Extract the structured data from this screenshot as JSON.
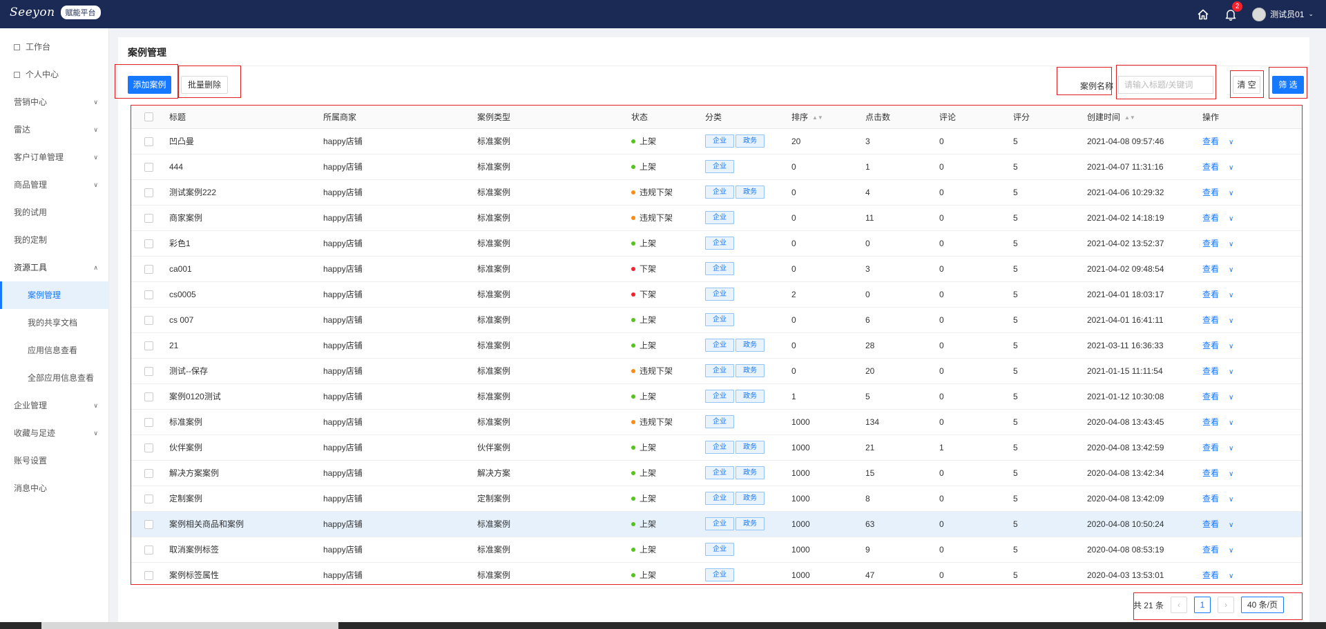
{
  "header": {
    "logo_text": "Seeyon",
    "platform_badge": "赋能平台",
    "notification_count": "2",
    "user_name": "测试员01"
  },
  "sidebar": {
    "items": [
      {
        "label": "工作台",
        "type": "page"
      },
      {
        "label": "个人中心",
        "type": "page"
      },
      {
        "label": "营销中心",
        "type": "group"
      },
      {
        "label": "雷达",
        "type": "group"
      },
      {
        "label": "客户订单管理",
        "type": "group"
      },
      {
        "label": "商品管理",
        "type": "group"
      },
      {
        "label": "我的试用",
        "type": "link"
      },
      {
        "label": "我的定制",
        "type": "link"
      },
      {
        "label": "资源工具",
        "type": "group-open"
      },
      {
        "label": "案例管理",
        "type": "sub-active"
      },
      {
        "label": "我的共享文档",
        "type": "sub"
      },
      {
        "label": "应用信息查看",
        "type": "sub"
      },
      {
        "label": "全部应用信息查看",
        "type": "sub"
      },
      {
        "label": "企业管理",
        "type": "group"
      },
      {
        "label": "收藏与足迹",
        "type": "group"
      },
      {
        "label": "账号设置",
        "type": "link"
      },
      {
        "label": "消息中心",
        "type": "link"
      }
    ]
  },
  "main": {
    "title": "案例管理",
    "add_button": "添加案例",
    "batch_delete_button": "批量删除",
    "filter_label": "案例名称",
    "filter_placeholder": "请输入标题/关键词",
    "clear_button": "清 空",
    "filter_button": "筛 选"
  },
  "table": {
    "columns": [
      "标题",
      "所属商家",
      "案例类型",
      "状态",
      "分类",
      "排序",
      "点击数",
      "评论",
      "评分",
      "创建时间",
      "操作"
    ],
    "view_label": "查看",
    "rows": [
      {
        "title": "凹凸曼",
        "merchant": "happy店铺",
        "type": "标准案例",
        "status": "上架",
        "status_color": "#52c41a",
        "tags": [
          "企业",
          "政务"
        ],
        "order": "20",
        "clicks": "3",
        "comments": "0",
        "rating": "5",
        "created": "2021-04-08 09:57:46"
      },
      {
        "title": "444",
        "merchant": "happy店铺",
        "type": "标准案例",
        "status": "上架",
        "status_color": "#52c41a",
        "tags": [
          "企业"
        ],
        "order": "0",
        "clicks": "1",
        "comments": "0",
        "rating": "5",
        "created": "2021-04-07 11:31:16"
      },
      {
        "title": "测试案例222",
        "merchant": "happy店铺",
        "type": "标准案例",
        "status": "违规下架",
        "status_color": "#fa8c16",
        "tags": [
          "企业",
          "政务"
        ],
        "order": "0",
        "clicks": "4",
        "comments": "0",
        "rating": "5",
        "created": "2021-04-06 10:29:32"
      },
      {
        "title": "商家案例",
        "merchant": "happy店铺",
        "type": "标准案例",
        "status": "违规下架",
        "status_color": "#fa8c16",
        "tags": [
          "企业"
        ],
        "order": "0",
        "clicks": "11",
        "comments": "0",
        "rating": "5",
        "created": "2021-04-02 14:18:19"
      },
      {
        "title": "彩色1",
        "merchant": "happy店铺",
        "type": "标准案例",
        "status": "上架",
        "status_color": "#52c41a",
        "tags": [
          "企业"
        ],
        "order": "0",
        "clicks": "0",
        "comments": "0",
        "rating": "5",
        "created": "2021-04-02 13:52:37"
      },
      {
        "title": "ca001",
        "merchant": "happy店铺",
        "type": "标准案例",
        "status": "下架",
        "status_color": "#f5222d",
        "tags": [
          "企业"
        ],
        "order": "0",
        "clicks": "3",
        "comments": "0",
        "rating": "5",
        "created": "2021-04-02 09:48:54"
      },
      {
        "title": "cs0005",
        "merchant": "happy店铺",
        "type": "标准案例",
        "status": "下架",
        "status_color": "#f5222d",
        "tags": [
          "企业"
        ],
        "order": "2",
        "clicks": "0",
        "comments": "0",
        "rating": "5",
        "created": "2021-04-01 18:03:17"
      },
      {
        "title": "cs 007",
        "merchant": "happy店铺",
        "type": "标准案例",
        "status": "上架",
        "status_color": "#52c41a",
        "tags": [
          "企业"
        ],
        "order": "0",
        "clicks": "6",
        "comments": "0",
        "rating": "5",
        "created": "2021-04-01 16:41:11"
      },
      {
        "title": "21",
        "merchant": "happy店铺",
        "type": "标准案例",
        "status": "上架",
        "status_color": "#52c41a",
        "tags": [
          "企业",
          "政务"
        ],
        "order": "0",
        "clicks": "28",
        "comments": "0",
        "rating": "5",
        "created": "2021-03-11 16:36:33"
      },
      {
        "title": "测试--保存",
        "merchant": "happy店铺",
        "type": "标准案例",
        "status": "违规下架",
        "status_color": "#fa8c16",
        "tags": [
          "企业",
          "政务"
        ],
        "order": "0",
        "clicks": "20",
        "comments": "0",
        "rating": "5",
        "created": "2021-01-15 11:11:54"
      },
      {
        "title": "案例0120测试",
        "merchant": "happy店铺",
        "type": "标准案例",
        "status": "上架",
        "status_color": "#52c41a",
        "tags": [
          "企业",
          "政务"
        ],
        "order": "1",
        "clicks": "5",
        "comments": "0",
        "rating": "5",
        "created": "2021-01-12 10:30:08"
      },
      {
        "title": "标准案例",
        "merchant": "happy店铺",
        "type": "标准案例",
        "status": "违规下架",
        "status_color": "#fa8c16",
        "tags": [
          "企业"
        ],
        "order": "1000",
        "clicks": "134",
        "comments": "0",
        "rating": "5",
        "created": "2020-04-08 13:43:45"
      },
      {
        "title": "伙伴案例",
        "merchant": "happy店铺",
        "type": "伙伴案例",
        "status": "上架",
        "status_color": "#52c41a",
        "tags": [
          "企业",
          "政务"
        ],
        "order": "1000",
        "clicks": "21",
        "comments": "1",
        "rating": "5",
        "created": "2020-04-08 13:42:59"
      },
      {
        "title": "解决方案案例",
        "merchant": "happy店铺",
        "type": "解决方案",
        "status": "上架",
        "status_color": "#52c41a",
        "tags": [
          "企业",
          "政务"
        ],
        "order": "1000",
        "clicks": "15",
        "comments": "0",
        "rating": "5",
        "created": "2020-04-08 13:42:34"
      },
      {
        "title": "定制案例",
        "merchant": "happy店铺",
        "type": "定制案例",
        "status": "上架",
        "status_color": "#52c41a",
        "tags": [
          "企业",
          "政务"
        ],
        "order": "1000",
        "clicks": "8",
        "comments": "0",
        "rating": "5",
        "created": "2020-04-08 13:42:09"
      },
      {
        "title": "案例相关商品和案例",
        "merchant": "happy店铺",
        "type": "标准案例",
        "status": "上架",
        "status_color": "#52c41a",
        "tags": [
          "企业",
          "政务"
        ],
        "order": "1000",
        "clicks": "63",
        "comments": "0",
        "rating": "5",
        "created": "2020-04-08 10:50:24",
        "highlight": true
      },
      {
        "title": "取消案例标签",
        "merchant": "happy店铺",
        "type": "标准案例",
        "status": "上架",
        "status_color": "#52c41a",
        "tags": [
          "企业"
        ],
        "order": "1000",
        "clicks": "9",
        "comments": "0",
        "rating": "5",
        "created": "2020-04-08 08:53:19"
      },
      {
        "title": "案例标签属性",
        "merchant": "happy店铺",
        "type": "标准案例",
        "status": "上架",
        "status_color": "#52c41a",
        "tags": [
          "企业"
        ],
        "order": "1000",
        "clicks": "47",
        "comments": "0",
        "rating": "5",
        "created": "2020-04-03 13:53:01"
      }
    ]
  },
  "pagination": {
    "total": "共 21 条",
    "current_page": "1",
    "page_size": "40 条/页"
  }
}
